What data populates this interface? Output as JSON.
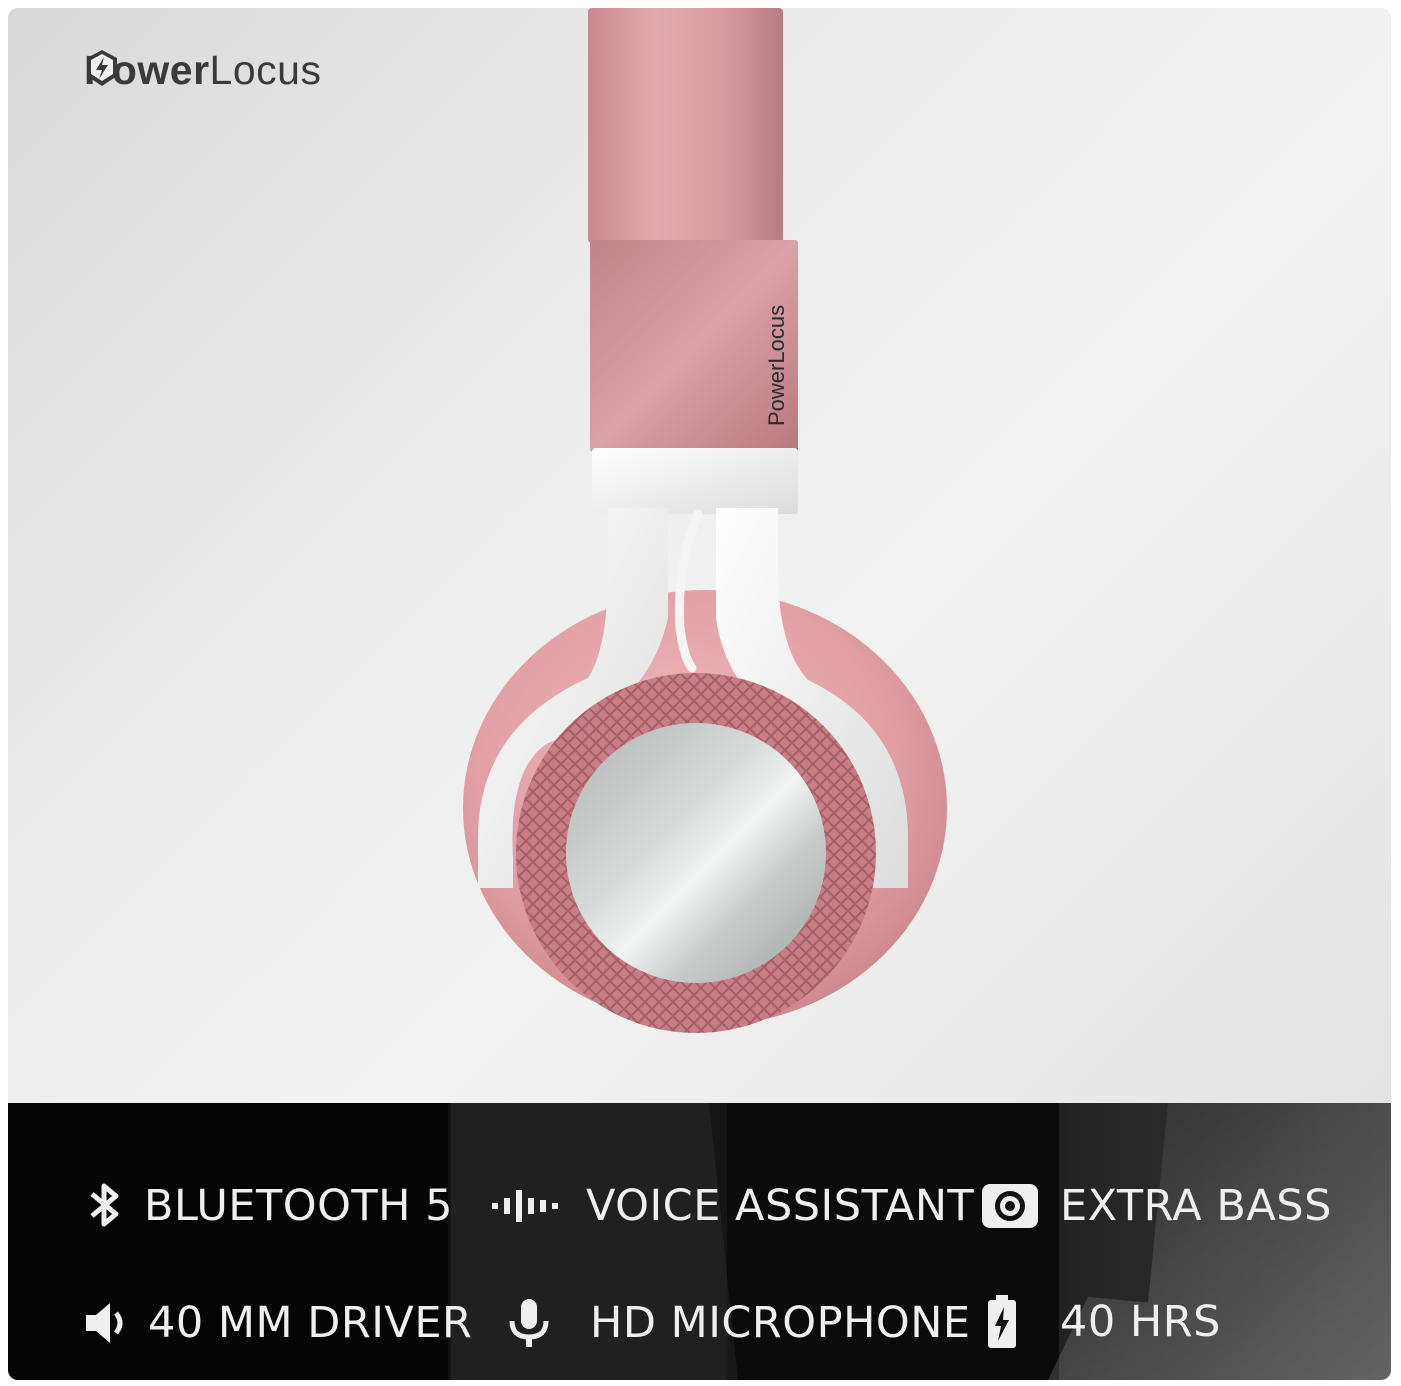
{
  "brand": {
    "word_bold": "Power",
    "word_light": "Locus",
    "icon": "power-bolt-shield-icon"
  },
  "product_band_text": "PowerLocus",
  "colors": {
    "rose_gold": "#d9949c",
    "white_plastic": "#f1f1f1",
    "silver": "#c9c9c9",
    "band_dark": "#050505",
    "feature_text": "#efefef"
  },
  "features": [
    {
      "icon": "bluetooth-icon",
      "label": "BLUETOOTH 5"
    },
    {
      "icon": "voice-wave-icon",
      "label": "VOICE ASSISTANT"
    },
    {
      "icon": "speaker-bass-icon",
      "label": "EXTRA BASS"
    },
    {
      "icon": "volume-icon",
      "label": "40 MM DRIVER"
    },
    {
      "icon": "microphone-icon",
      "label": "HD MICROPHONE"
    },
    {
      "icon": "battery-icon",
      "label": "40 HRS"
    }
  ]
}
